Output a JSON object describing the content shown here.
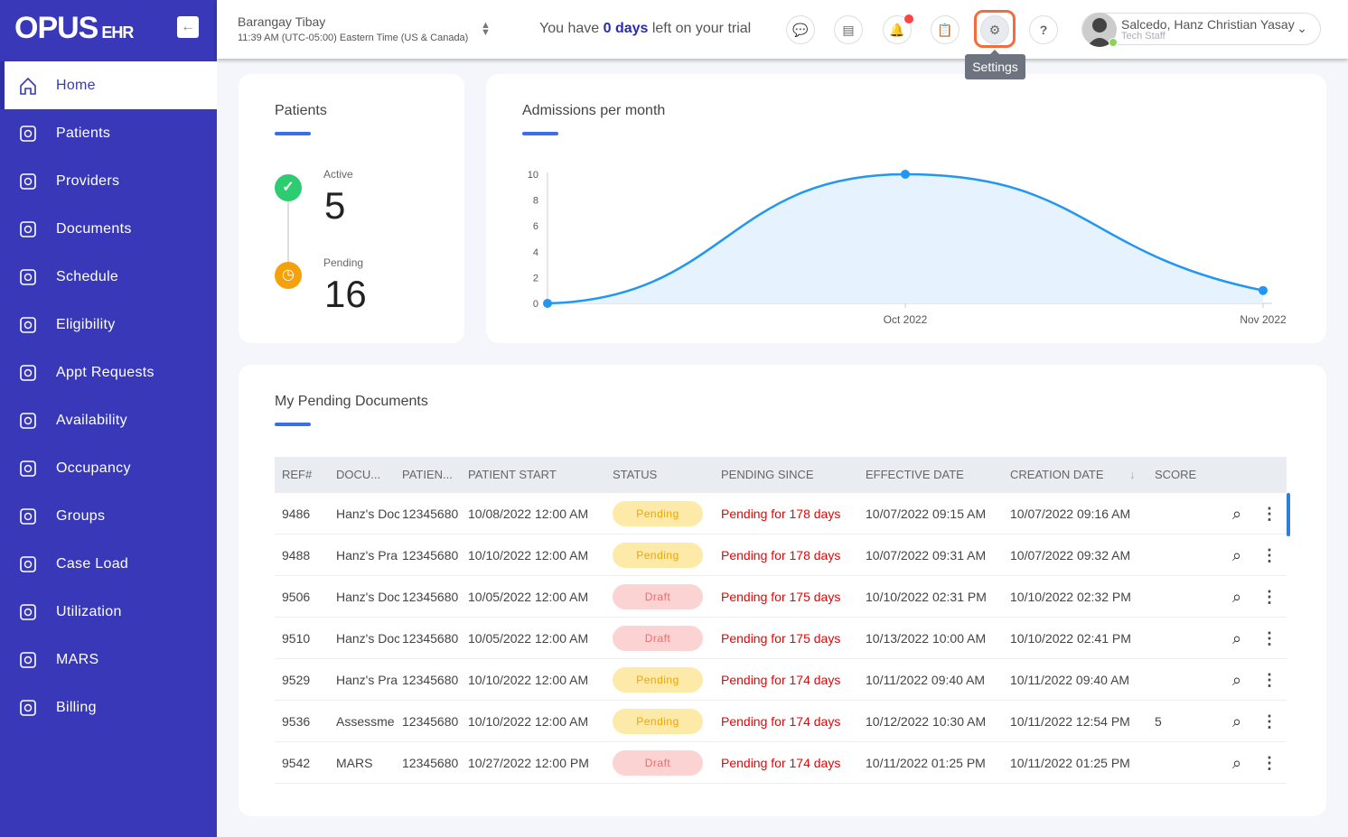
{
  "app": {
    "logo": "OPUS",
    "logo_suffix": "EHR"
  },
  "sidebar": {
    "items": [
      {
        "label": "Home",
        "icon": "home-icon"
      },
      {
        "label": "Patients",
        "icon": "users-icon"
      },
      {
        "label": "Providers",
        "icon": "users-icon"
      },
      {
        "label": "Documents",
        "icon": "documents-icon"
      },
      {
        "label": "Schedule",
        "icon": "calendar-icon"
      },
      {
        "label": "Eligibility",
        "icon": "user-check-icon"
      },
      {
        "label": "Appt Requests",
        "icon": "clock-icon"
      },
      {
        "label": "Availability",
        "icon": "clock-icon"
      },
      {
        "label": "Occupancy",
        "icon": "bed-icon"
      },
      {
        "label": "Groups",
        "icon": "group-icon"
      },
      {
        "label": "Case Load",
        "icon": "user-settings-icon"
      },
      {
        "label": "Utilization",
        "icon": "clipboard-check-icon"
      },
      {
        "label": "MARS",
        "icon": "pills-icon"
      },
      {
        "label": "Billing",
        "icon": "invoice-icon"
      }
    ]
  },
  "header": {
    "location": "Barangay Tibay",
    "time": "11:39 AM (UTC-05:00) Eastern Time (US & Canada)",
    "trial_pre": "You have ",
    "trial_days": "0 days",
    "trial_post": " left on your trial",
    "tooltip": "Settings",
    "user_name": "Salcedo, Hanz Christian Yasay",
    "user_role": "Tech Staff"
  },
  "patients": {
    "title": "Patients",
    "active_label": "Active",
    "active": "5",
    "pending_label": "Pending",
    "pending": "16"
  },
  "chart_data": {
    "type": "area",
    "title": "Admissions per month",
    "x": [
      "",
      "Oct 2022",
      "Nov 2022"
    ],
    "values": [
      0,
      10,
      1
    ],
    "ylim": [
      0,
      10
    ],
    "yticks": [
      "0",
      "2",
      "4",
      "6",
      "8",
      "10"
    ],
    "color": "#2196f3"
  },
  "docs": {
    "title": "My Pending Documents",
    "columns": [
      "REF#",
      "DOCU...",
      "PATIEN...",
      "PATIENT START",
      "STATUS",
      "PENDING SINCE",
      "EFFECTIVE DATE",
      "CREATION DATE",
      "SCORE"
    ],
    "rows": [
      [
        "9486",
        "Hanz's Doc",
        "12345680",
        "10/08/2022 12:00 AM",
        "Pending",
        "Pending for 178 days",
        "10/07/2022 09:15 AM",
        "10/07/2022 09:16 AM",
        ""
      ],
      [
        "9488",
        "Hanz's Pra",
        "12345680",
        "10/10/2022 12:00 AM",
        "Pending",
        "Pending for 178 days",
        "10/07/2022 09:31 AM",
        "10/07/2022 09:32 AM",
        ""
      ],
      [
        "9506",
        "Hanz's Doc",
        "12345680",
        "10/05/2022 12:00 AM",
        "Draft",
        "Pending for 175 days",
        "10/10/2022 02:31 PM",
        "10/10/2022 02:32 PM",
        ""
      ],
      [
        "9510",
        "Hanz's Doc",
        "12345680",
        "10/05/2022 12:00 AM",
        "Draft",
        "Pending for 175 days",
        "10/13/2022 10:00 AM",
        "10/10/2022 02:41 PM",
        ""
      ],
      [
        "9529",
        "Hanz's Pra",
        "12345680",
        "10/10/2022 12:00 AM",
        "Pending",
        "Pending for 174 days",
        "10/11/2022 09:40 AM",
        "10/11/2022 09:40 AM",
        ""
      ],
      [
        "9536",
        "Assessme",
        "12345680",
        "10/10/2022 12:00 AM",
        "Pending",
        "Pending for 174 days",
        "10/12/2022 10:30 AM",
        "10/11/2022 12:54 PM",
        "5"
      ],
      [
        "9542",
        "MARS",
        "12345680",
        "10/27/2022 12:00 PM",
        "Draft",
        "Pending for 174 days",
        "10/11/2022 01:25 PM",
        "10/11/2022 01:25 PM",
        ""
      ]
    ]
  }
}
